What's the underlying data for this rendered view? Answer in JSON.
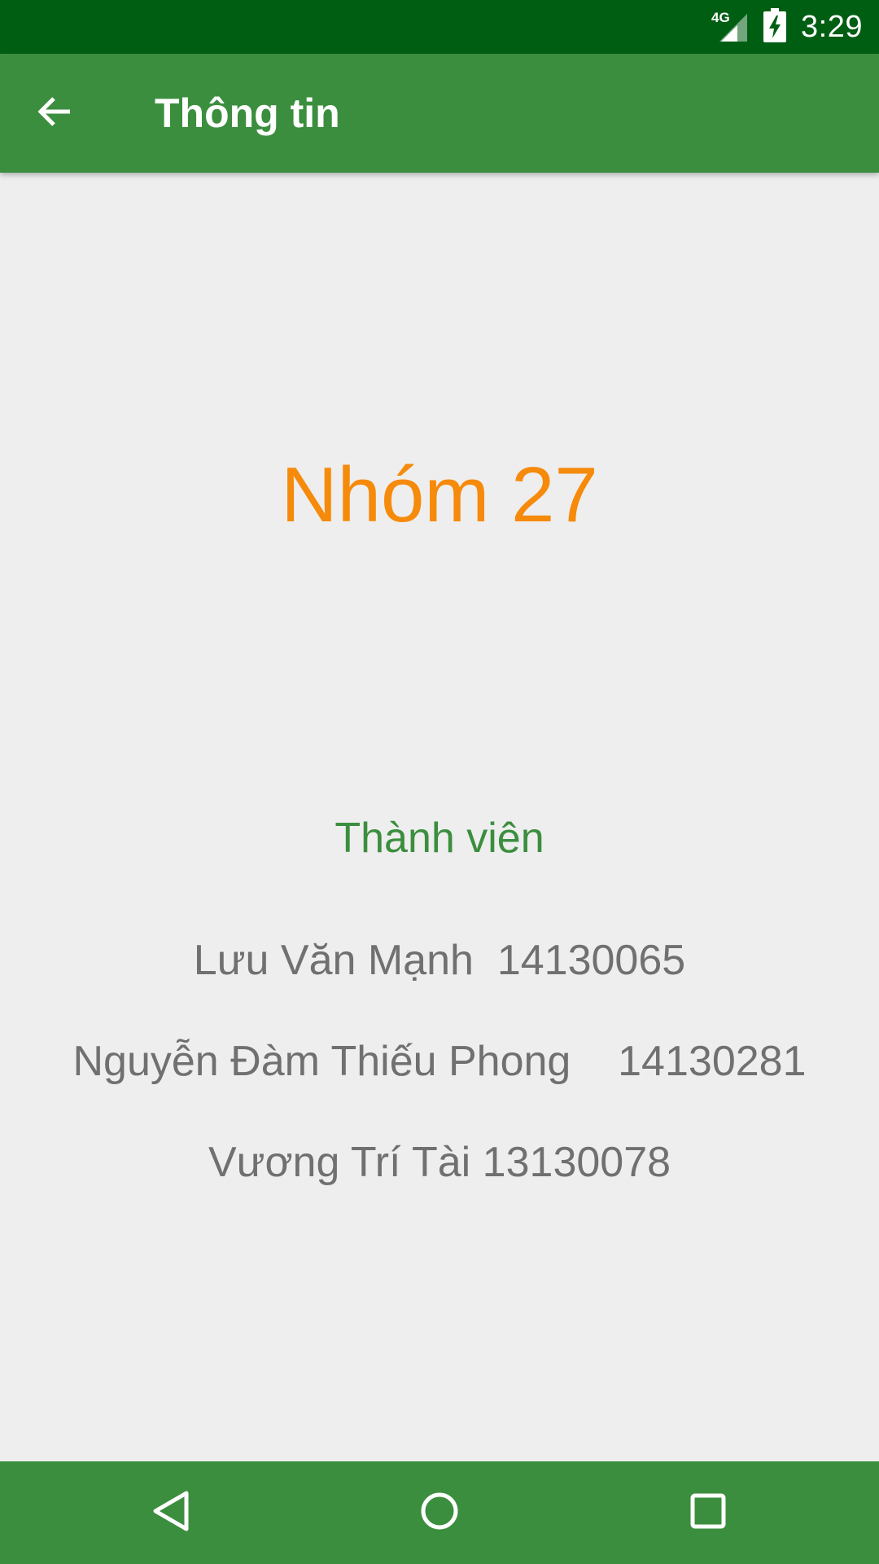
{
  "status_bar": {
    "network_label": "4G",
    "time": "3:29",
    "icons": [
      "signal-icon",
      "battery-charging-icon"
    ]
  },
  "app_bar": {
    "title": "Thông tin",
    "back_icon": "arrow-back-icon"
  },
  "main": {
    "group_title": "Nhóm 27",
    "members_heading": "Thành viên",
    "members": [
      {
        "text": "Lưu Văn Mạnh  14130065"
      },
      {
        "text": "Nguyễn Đàm Thiếu Phong    14130281"
      },
      {
        "text": "Vương Trí Tài 13130078"
      }
    ]
  },
  "nav_bar": {
    "icons": [
      "nav-back-icon",
      "nav-home-icon",
      "nav-recents-icon"
    ]
  },
  "colors": {
    "status_bar": "#005e13",
    "primary": "#3b8e3e",
    "accent": "#f68a0b",
    "background": "#eeeeee",
    "member_text": "#707070"
  }
}
